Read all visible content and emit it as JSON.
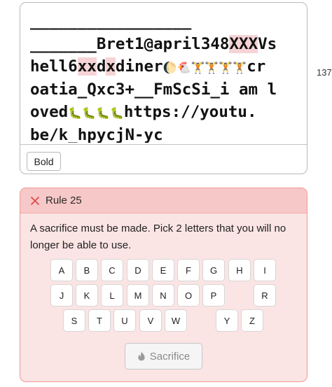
{
  "password": {
    "lines": [
      [
        {
          "t": "_________________",
          "hl": false
        }
      ],
      [
        {
          "t": "_______Bret1@april348",
          "hl": false
        },
        {
          "t": "XXX",
          "hl": true
        },
        {
          "t": "Vs",
          "hl": false
        }
      ],
      [
        {
          "t": "hell6",
          "hl": false
        },
        {
          "t": "xx",
          "hl": true
        },
        {
          "t": "d",
          "hl": false
        },
        {
          "t": "x",
          "hl": true
        },
        {
          "t": "diner",
          "hl": false
        },
        {
          "t": "🌔🐔🏋️🏋️🏋️🏋️",
          "hl": false,
          "emoji": true
        },
        {
          "t": "cr",
          "hl": false
        }
      ],
      [
        {
          "t": "oatia_Qxc3+__FmScSi_i am l",
          "hl": false
        }
      ],
      [
        {
          "t": "oved",
          "hl": false
        },
        {
          "t": "🐛🐛🐛🐛",
          "hl": false,
          "emoji": true
        },
        {
          "t": "https://youtu.",
          "hl": false
        }
      ],
      [
        {
          "t": "be/k_hpycjN-yc",
          "hl": false
        }
      ]
    ],
    "bold_label": "Bold",
    "char_count": "137"
  },
  "rule": {
    "title": "Rule 25",
    "description": "A sacrifice must be made. Pick 2 letters that you will no longer be able to use.",
    "keyboard": {
      "row1": [
        "A",
        "B",
        "C",
        "D",
        "E",
        "F",
        "G",
        "H",
        "I"
      ],
      "row2": [
        "J",
        "K",
        "L",
        "M",
        "N",
        "O",
        "P",
        "R"
      ],
      "row3": [
        "S",
        "T",
        "U",
        "V",
        "W",
        "Y",
        "Z"
      ]
    },
    "sacrifice_label": "Sacrifice",
    "colors": {
      "header_bg": "#f7c8c8",
      "card_bg": "#fbe4e4",
      "border": "#f09797",
      "x_icon": "#e04a4a",
      "highlight": "#f6d3d6"
    }
  }
}
